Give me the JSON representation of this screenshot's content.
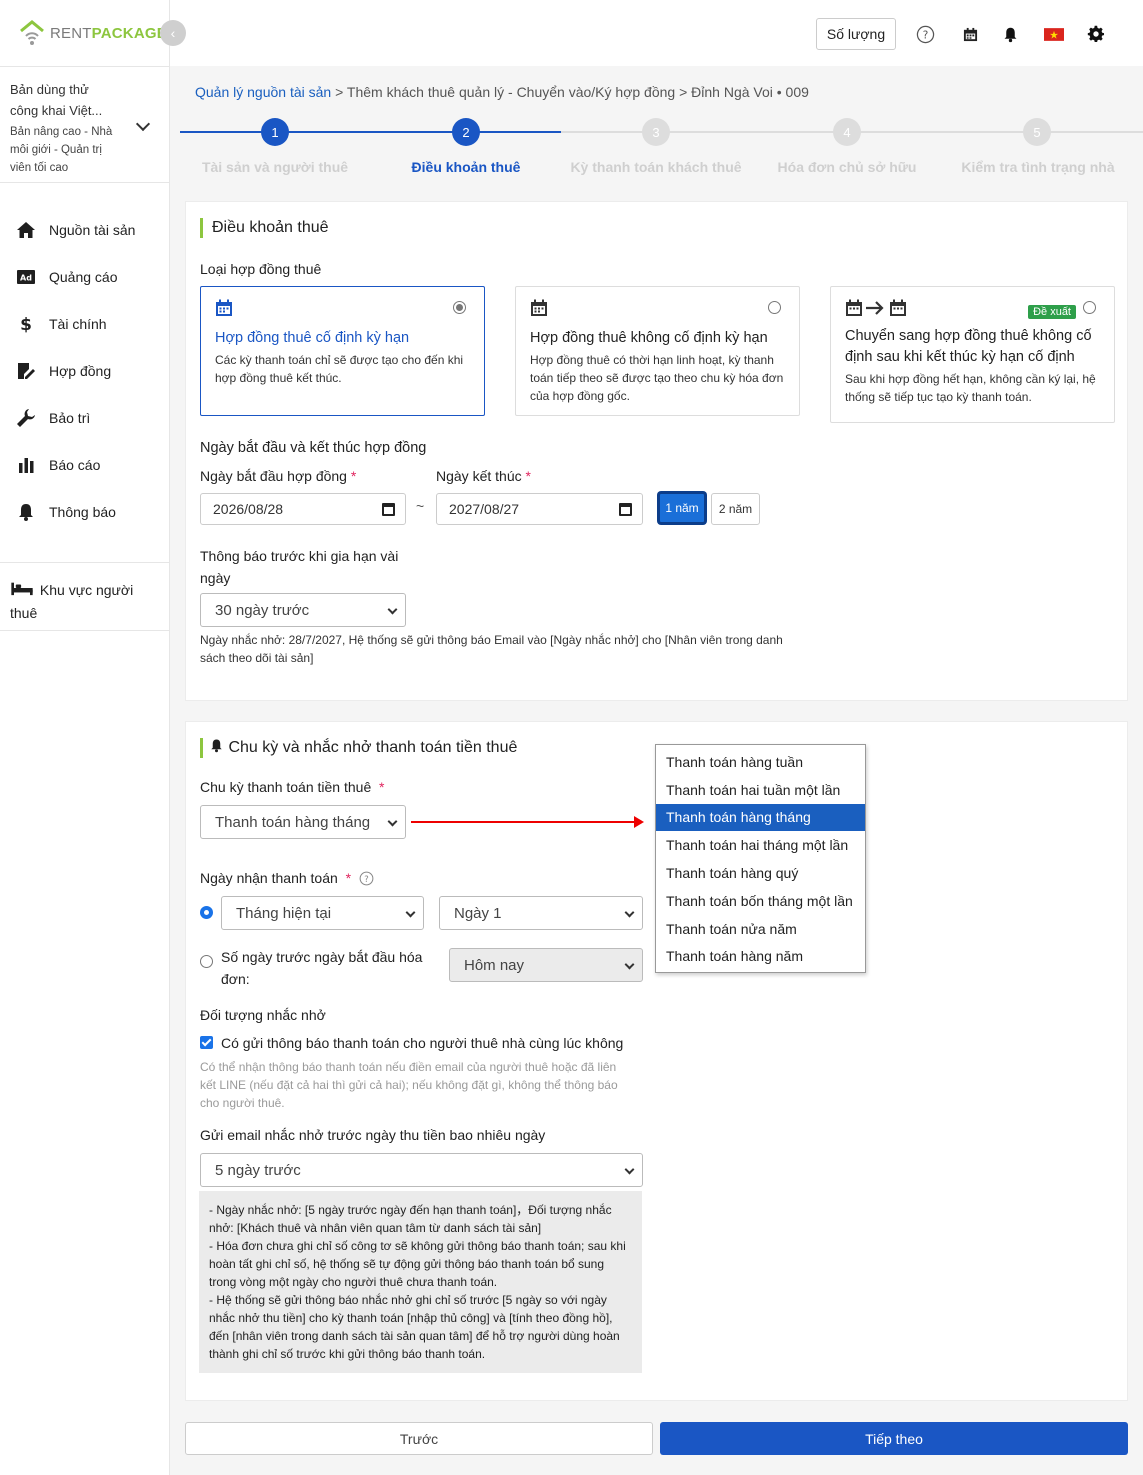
{
  "brand": {
    "rent": "RENT",
    "package": "PACKAGE"
  },
  "plan": {
    "title": "Bản dùng thử công khai Việt...",
    "subtitle": "Bản nâng cao - Nhà môi giới - Quản trị viên tối cao"
  },
  "sidebar": {
    "items": [
      {
        "label": "Nguồn tài sản",
        "icon": "home-icon"
      },
      {
        "label": "Quảng cáo",
        "icon": "ad-icon"
      },
      {
        "label": "Tài chính",
        "icon": "dollar-icon"
      },
      {
        "label": "Hợp đồng",
        "icon": "contract-icon"
      },
      {
        "label": "Bảo trì",
        "icon": "wrench-icon"
      },
      {
        "label": "Báo cáo",
        "icon": "bar-chart-icon"
      },
      {
        "label": "Thông báo",
        "icon": "bell-icon"
      }
    ],
    "tenant_area": "Khu vực người thuê"
  },
  "topbar": {
    "quantity_label": "Số lượng"
  },
  "breadcrumb": {
    "root": "Quản lý nguồn tài sản",
    "rest": " > Thêm khách thuê quản lý - Chuyển vào/Ký hợp đồng > Đỉnh Ngà Voi • 009"
  },
  "steps": [
    {
      "num": "1",
      "label": "Tài sản và người thuê"
    },
    {
      "num": "2",
      "label": "Điều khoản thuê"
    },
    {
      "num": "3",
      "label": "Kỳ thanh toán khách thuê"
    },
    {
      "num": "4",
      "label": "Hóa đơn chủ sở hữu"
    },
    {
      "num": "5",
      "label": "Kiểm tra tình trạng nhà"
    }
  ],
  "terms": {
    "title": "Điều khoản thuê",
    "contract_type_label": "Loại hợp đồng thuê",
    "options": [
      {
        "title": "Hợp đồng thuê cố định kỳ hạn",
        "desc": "Các kỳ thanh toán chỉ sẽ được tạo cho đến khi hợp đồng thuê kết thúc."
      },
      {
        "title": "Hợp đồng thuê không cố định kỳ hạn",
        "desc": "Hợp đồng thuê có thời hạn linh hoạt, kỳ thanh toán tiếp theo sẽ được tạo theo chu kỳ hóa đơn của hợp đồng gốc."
      },
      {
        "title": "Chuyển sang hợp đồng thuê không cố định sau khi kết thúc kỳ hạn cố định",
        "desc": "Sau khi hợp đồng hết hạn, không cần ký lại, hệ thống sẽ tiếp tục tạo kỳ thanh toán.",
        "badge": "Đề xuất"
      }
    ],
    "dates_section": "Ngày bắt đầu và kết thúc hợp đồng",
    "start_label": "Ngày bắt đầu hợp đồng",
    "end_label": "Ngày kết thúc",
    "start_value": "2026/08/28",
    "end_value": "2027/08/27",
    "tilde": "~",
    "year1": "1 năm",
    "year2": "2 năm",
    "renew_label": "Thông báo trước khi gia hạn vài ngày",
    "renew_value": "30 ngày trước",
    "renew_note": "Ngày nhắc nhở: 28/7/2027, Hệ thống sẽ gửi thông báo Email vào [Ngày nhắc nhở] cho [Nhân viên trong danh sách theo dõi tài sản]"
  },
  "payment": {
    "title": "Chu kỳ và nhắc nhở thanh toán tiền thuê",
    "cycle_label": "Chu kỳ thanh toán tiền thuê",
    "cycle_value": "Thanh toán hàng tháng",
    "cycle_options": [
      "Thanh toán hàng tuần",
      "Thanh toán hai tuần một lần",
      "Thanh toán hàng tháng",
      "Thanh toán hai tháng một lần",
      "Thanh toán hàng quý",
      "Thanh toán bốn tháng một lần",
      "Thanh toán nửa năm",
      "Thanh toán hàng năm"
    ],
    "receive_label": "Ngày nhận thanh toán",
    "month_value": "Tháng hiện tại",
    "day_value": "Ngày 1",
    "days_before_label": "Số ngày trước ngày bắt đầu hóa đơn:",
    "today_value": "Hôm nay",
    "target_label": "Đối tượng nhắc nhở",
    "checkbox_label": "Có gửi thông báo thanh toán cho người thuê nhà cùng lúc không",
    "checkbox_hint": "Có thể nhận thông báo thanh toán nếu điền email của người thuê hoặc đã liên kết LINE (nếu đặt cả hai thì gửi cả hai); nếu không đặt gì, không thể thông báo cho người thuê.",
    "email_label": "Gửi email nhắc nhở trước ngày thu tiền bao nhiêu ngày",
    "email_value": "5 ngày trước",
    "info_lines": [
      "- Ngày nhắc nhở: [5 ngày trước ngày đến hạn thanh toán]，Đối tượng nhắc nhở: [Khách thuê và nhân viên quan tâm từ danh sách tài sản]",
      "- Hóa đơn chưa ghi chỉ số công tơ sẽ không gửi thông báo thanh toán; sau khi hoàn tất ghi chỉ số, hệ thống sẽ tự động gửi thông báo thanh toán bổ sung trong vòng một ngày cho người thuê chưa thanh toán.",
      "- Hệ thống sẽ gửi thông báo nhắc nhở ghi chỉ số trước [5 ngày so với ngày nhắc nhở thu tiền] cho kỳ thanh toán [nhập thủ công] và [tính theo đồng hồ], đến [nhân viên trong danh sách tài sản quan tâm] để hỗ trợ người dùng hoàn thành ghi chỉ số trước khi gửi thông báo thanh toán."
    ]
  },
  "footer": {
    "prev": "Trước",
    "next": "Tiếp theo"
  },
  "colors": {
    "primary": "#1a56c4",
    "brand_green": "#8dc63f",
    "badge_green": "#2e9f4a",
    "arrow_red": "#e00000"
  }
}
